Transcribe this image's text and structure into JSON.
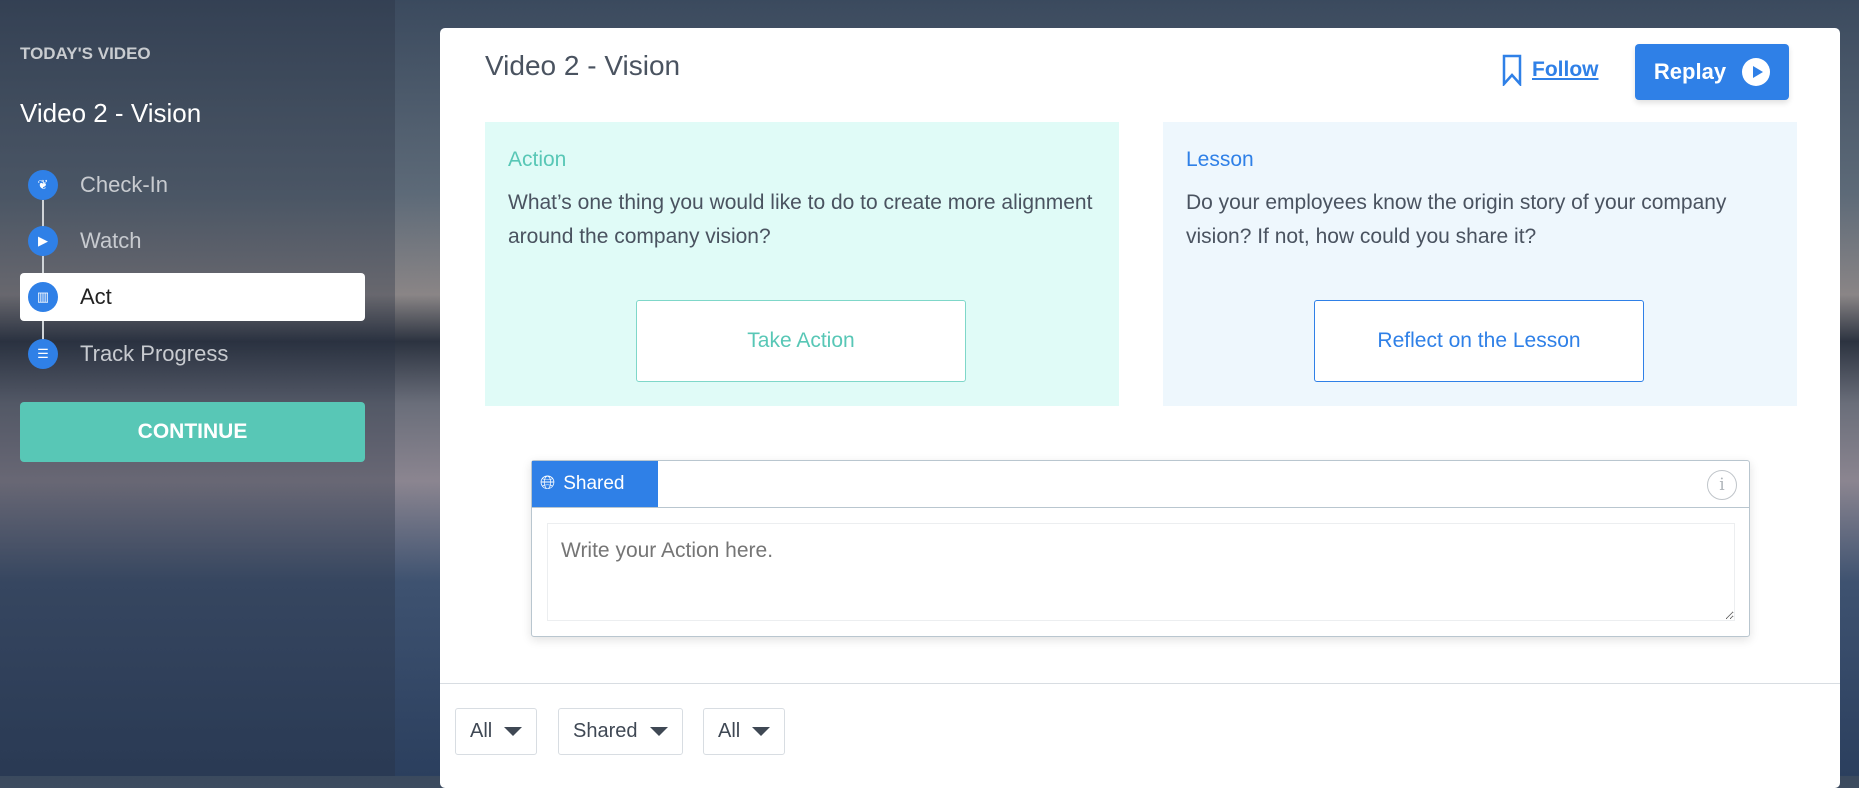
{
  "sidebar": {
    "label": "TODAY'S VIDEO",
    "title": "Video 2 - Vision",
    "steps": [
      {
        "label": "Check-In",
        "icon": "leaf-icon"
      },
      {
        "label": "Watch",
        "icon": "play-icon"
      },
      {
        "label": "Act",
        "icon": "book-icon",
        "active": true
      },
      {
        "label": "Track Progress",
        "icon": "list-icon"
      }
    ],
    "continue": "CONTINUE"
  },
  "main": {
    "title": "Video 2 - Vision",
    "follow": "Follow",
    "replay": "Replay",
    "action": {
      "heading": "Action",
      "text": "What’s one thing you would like to do to create more alignment around the company vision?",
      "button": "Take Action"
    },
    "lesson": {
      "heading": "Lesson",
      "text": "Do your employees know the origin story of your company vision? If not, how could you share it?",
      "button": "Reflect on the Lesson"
    },
    "editor": {
      "tab": "Shared",
      "info": "i",
      "placeholder": "Write your Action here."
    },
    "filters": [
      "All",
      "Shared",
      "All"
    ]
  },
  "colors": {
    "accent": "#2f80e7",
    "teal": "#58c7b6"
  }
}
